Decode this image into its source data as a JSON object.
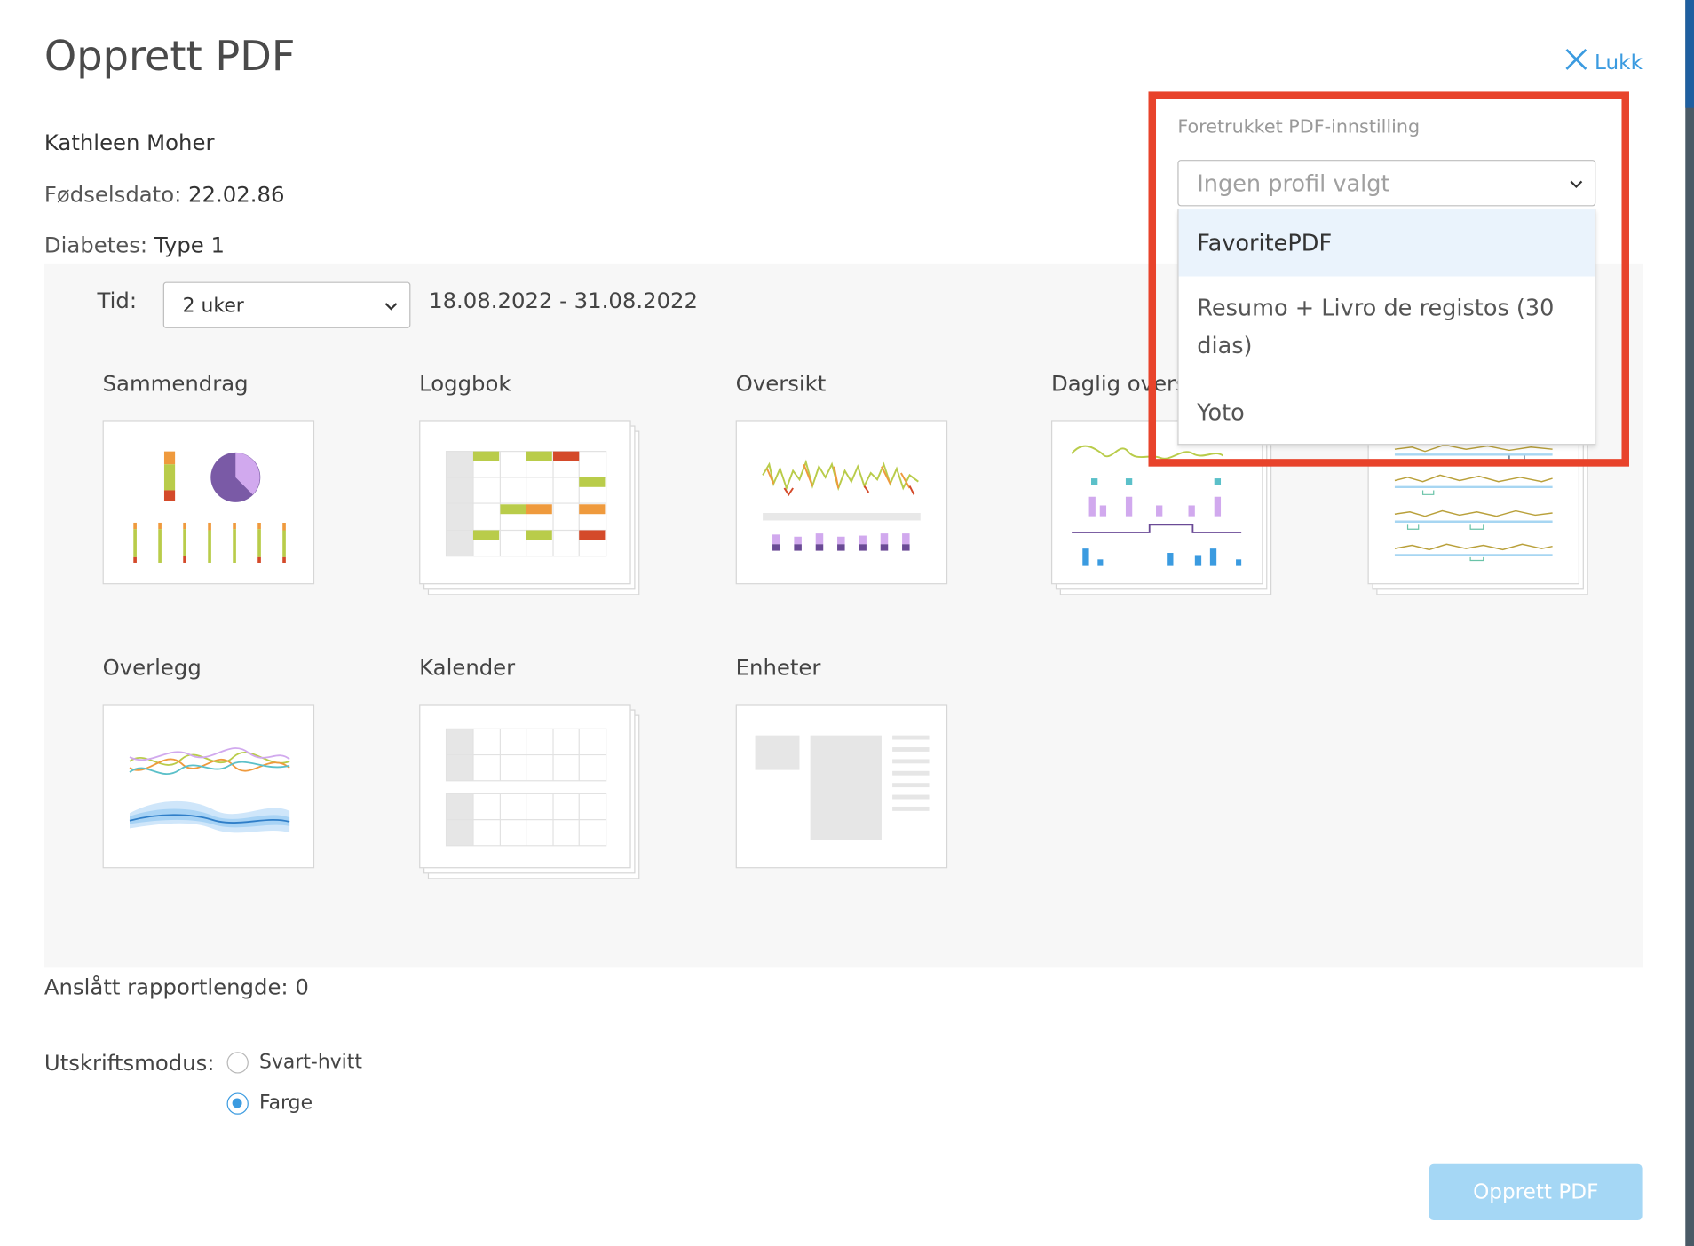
{
  "dialog": {
    "title": "Opprett PDF",
    "close_label": "Lukk"
  },
  "patient": {
    "name": "Kathleen Moher",
    "birth_label": "Fødselsdato:",
    "birth_value": "22.02.86",
    "diabetes_label": "Diabetes:",
    "diabetes_value": "Type 1"
  },
  "time": {
    "label": "Tid:",
    "selected": "2 uker",
    "range": "18.08.2022 - 31.08.2022"
  },
  "reports": [
    {
      "label": "Sammendrag"
    },
    {
      "label": "Loggbok"
    },
    {
      "label": "Oversikt"
    },
    {
      "label": "Daglig oversikt"
    },
    {
      "label": "Overlegg"
    },
    {
      "label": "Kalender"
    },
    {
      "label": "Enheter"
    }
  ],
  "estimate": {
    "label": "Anslått rapportlengde: 0"
  },
  "print_mode": {
    "label": "Utskriftsmodus:",
    "options": [
      "Svart-hvitt",
      "Farge"
    ],
    "selected": "Farge"
  },
  "create_button": "Opprett PDF",
  "profile": {
    "label": "Foretrukket PDF-innstilling",
    "placeholder": "Ingen profil valgt",
    "options": [
      {
        "label": "FavoritePDF",
        "line1": "FavoritePDF"
      },
      {
        "label": "Resumo + Livro de registos (30 dias)",
        "line1": "Resumo + Livro de registos (30",
        "line2": "dias)"
      },
      {
        "label": "Yoto",
        "line1": "Yoto"
      }
    ],
    "highlighted_option": "FavoritePDF"
  },
  "colors": {
    "accent": "#3b9be0",
    "highlight_border": "#e8432b",
    "button_disabled": "#a5d7f5"
  }
}
